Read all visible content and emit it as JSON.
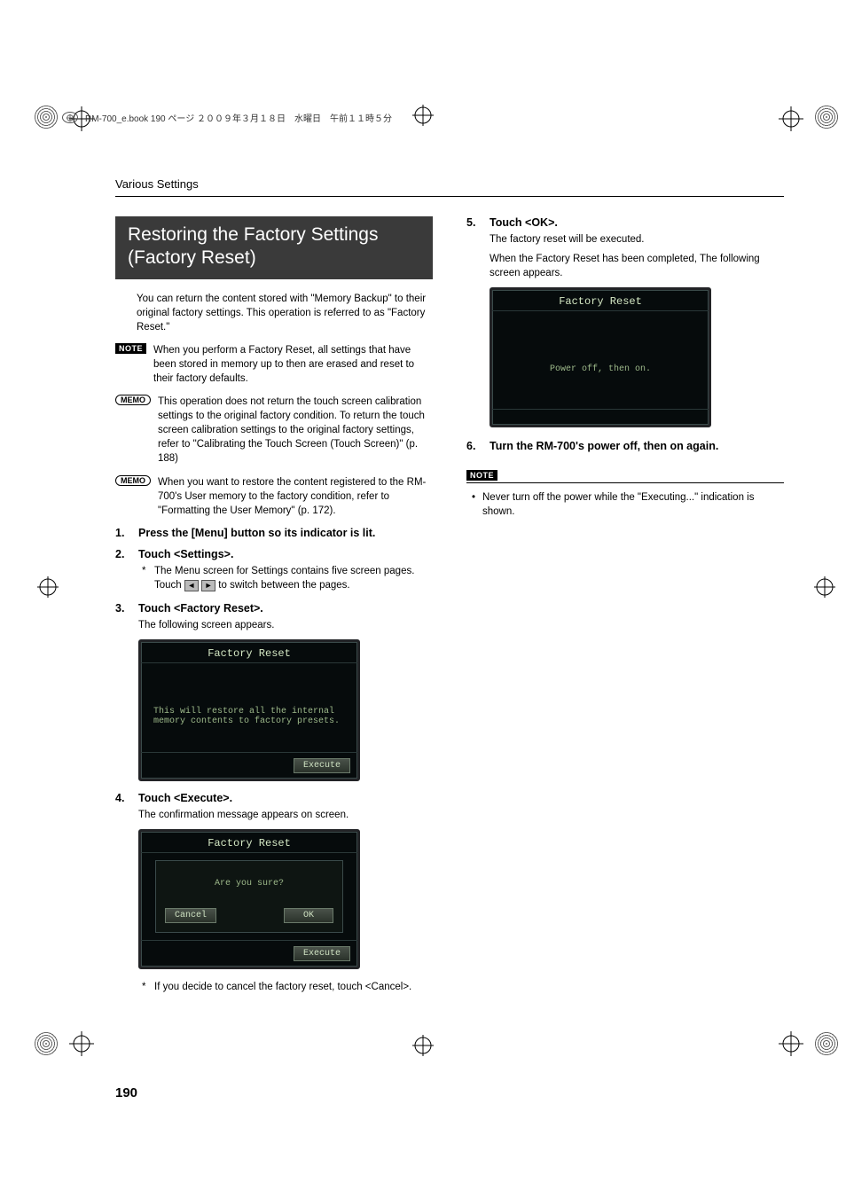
{
  "header": {
    "book_info": "RM-700_e.book  190 ページ  ２００９年３月１８日　水曜日　午前１１時５分"
  },
  "section_header": "Various Settings",
  "title": "Restoring the Factory Settings (Factory Reset)",
  "intro": "You can return the content stored with \"Memory Backup\" to their original factory settings. This operation is referred to as \"Factory Reset.\"",
  "note1": {
    "label": "NOTE",
    "text": "When you perform a Factory Reset, all settings that have been stored in memory up to then are erased and reset to their factory defaults."
  },
  "memo1": {
    "label": "MEMO",
    "text": "This operation does not return the touch screen calibration settings to the original factory condition. To return the touch screen calibration settings to the original factory settings, refer to \"Calibrating the Touch Screen (Touch Screen)\" (p. 188)"
  },
  "memo2": {
    "label": "MEMO",
    "text": "When you want to restore the content registered to the RM-700's User memory to the factory condition, refer to \"Formatting the User Memory\" (p. 172)."
  },
  "steps_left": {
    "s1": {
      "head": "Press the [Menu] button so its indicator is lit."
    },
    "s2": {
      "head": "Touch <Settings>.",
      "star_a": "The Menu screen for Settings contains five screen pages.",
      "star_b_pre": "Touch ",
      "star_b_post": " to switch between the pages."
    },
    "s3": {
      "head": "Touch <Factory Reset>.",
      "body": "The following screen appears."
    },
    "s4": {
      "head": "Touch <Execute>.",
      "body": "The confirmation message appears on screen.",
      "star": "If you decide to cancel the factory reset, touch <Cancel>."
    }
  },
  "steps_right": {
    "s5": {
      "head": "Touch <OK>.",
      "body1": "The factory reset will be executed.",
      "body2": "When the Factory Reset has been completed, The following screen appears."
    },
    "s6": {
      "head": "Turn the RM-700's power off, then on again."
    }
  },
  "note2": {
    "label": "NOTE",
    "text": "Never turn off the power while the \"Executing...\" indication is shown."
  },
  "screens": {
    "s3": {
      "title": "Factory Reset",
      "msg": "This will restore all the internal\nmemory contents to factory presets.",
      "execute": "Execute"
    },
    "s4": {
      "title": "Factory Reset",
      "prompt": "Are you sure?",
      "cancel": "Cancel",
      "ok": "OK",
      "execute": "Execute"
    },
    "s5": {
      "title": "Factory Reset",
      "msg": "Power off, then on."
    }
  },
  "page_number": "190"
}
